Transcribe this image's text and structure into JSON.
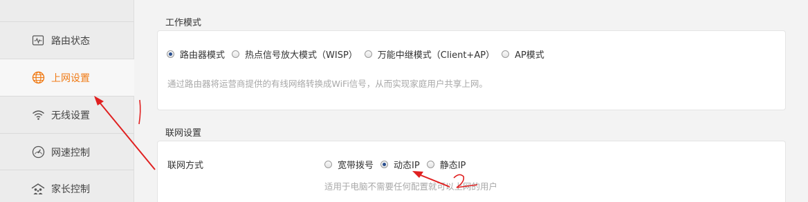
{
  "sidebar": {
    "items": [
      {
        "label": "路由状态",
        "icon": "monitor-icon",
        "active": false
      },
      {
        "label": "上网设置",
        "icon": "globe-icon",
        "active": true
      },
      {
        "label": "无线设置",
        "icon": "wifi-icon",
        "active": false
      },
      {
        "label": "网速控制",
        "icon": "speedometer-icon",
        "active": false
      },
      {
        "label": "家长控制",
        "icon": "family-icon",
        "active": false
      }
    ]
  },
  "work_mode": {
    "title": "工作模式",
    "options": [
      "路由器模式",
      "热点信号放大模式（WISP）",
      "万能中继模式（Client+AP）",
      "AP模式"
    ],
    "selected": "路由器模式",
    "description": "通过路由器将运营商提供的有线网络转换成WiFi信号，从而实现家庭用户共享上网。"
  },
  "network": {
    "title": "联网设置",
    "field_label": "联网方式",
    "options": [
      "宽带拨号",
      "动态IP",
      "静态IP"
    ],
    "selected": "动态IP",
    "description": "适用于电脑不需要任何配置就可以上网的用户"
  },
  "colors": {
    "accent": "#f07a14",
    "annotation": "#e02020",
    "radio_dot": "#2a4f8e"
  }
}
